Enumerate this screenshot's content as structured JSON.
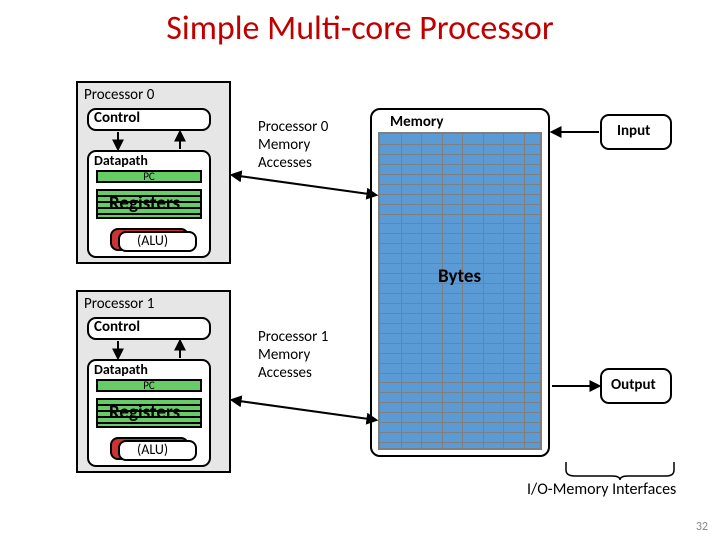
{
  "title": "Simple Multi-core Processor",
  "page_number": "32",
  "proc0": {
    "label": "Processor 0",
    "control": "Control",
    "datapath": "Datapath",
    "pc": "PC",
    "registers": "Registers",
    "alu": "(ALU)",
    "mem_access": "Processor 0\nMemory\nAccesses"
  },
  "proc1": {
    "label": "Processor 1",
    "control": "Control",
    "datapath": "Datapath",
    "pc": "PC",
    "registers": "Registers",
    "alu": "(ALU)",
    "mem_access": "Processor 1\nMemory\nAccesses"
  },
  "memory": {
    "label": "Memory",
    "bytes": "Bytes"
  },
  "io": {
    "input": "Input",
    "output": "Output",
    "interfaces": "I/O-Memory Interfaces"
  }
}
